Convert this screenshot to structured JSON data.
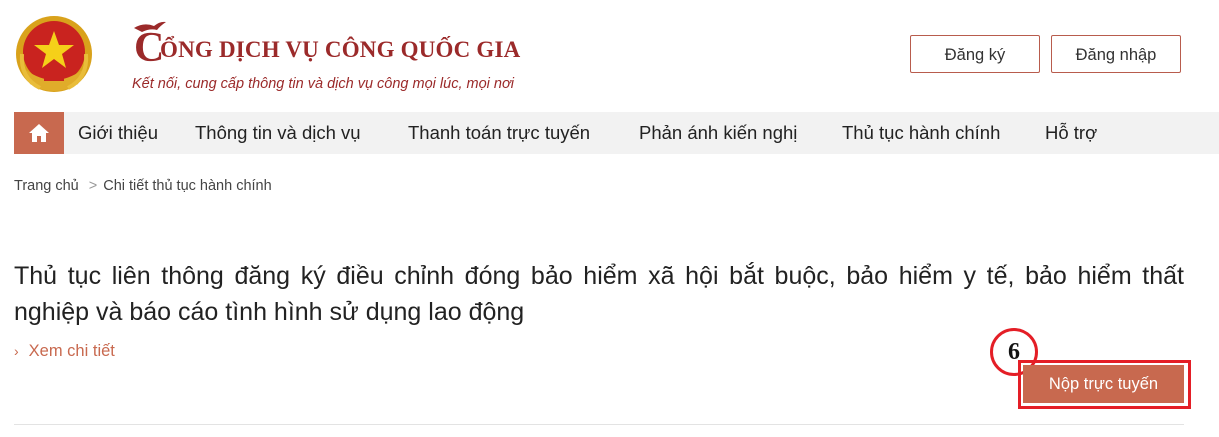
{
  "header": {
    "title_initial": "C",
    "title_rest": "ỔNG DỊCH VỤ CÔNG QUỐC GIA",
    "tagline": "Kết nối, cung cấp thông tin và dịch vụ công mọi lúc, mọi nơi",
    "register_label": "Đăng ký",
    "login_label": "Đăng nhập"
  },
  "nav": {
    "items": [
      {
        "label": "Giới thiệu"
      },
      {
        "label": "Thông tin và dịch vụ"
      },
      {
        "label": "Thanh toán trực tuyến"
      },
      {
        "label": "Phản ánh kiến nghị"
      },
      {
        "label": "Thủ tục hành chính"
      },
      {
        "label": "Hỗ trợ"
      }
    ]
  },
  "breadcrumb": {
    "home": "Trang chủ",
    "separator": ">",
    "current": "Chi tiết thủ tục hành chính"
  },
  "procedure": {
    "title": "Thủ tục liên thông đăng ký điều chỉnh đóng bảo hiểm xã hội bắt buộc, bảo hiểm y tế, bảo hiểm thất nghiệp và báo cáo tình hình sử dụng lao động",
    "detail_link": "Xem chi tiết",
    "submit_label": "Nộp trực tuyến"
  },
  "annotation": {
    "step_number": "6",
    "highlight_color": "#e41e26"
  },
  "colors": {
    "brand": "#9b2a2a",
    "accent": "#c8694f",
    "nav_bg": "#f2f2f2"
  }
}
